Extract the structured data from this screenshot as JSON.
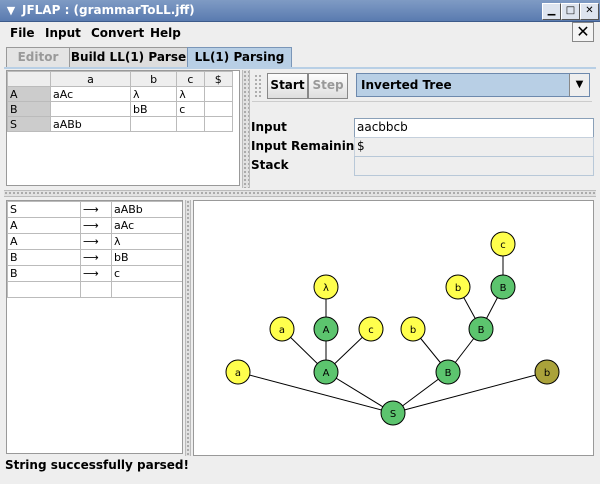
{
  "window": {
    "title": "JFLAP : (grammarToLL.jff)"
  },
  "menu": {
    "file": "File",
    "input": "Input",
    "convert": "Convert",
    "help": "Help"
  },
  "tabs": {
    "editor": "Editor",
    "build": "Build LL(1) Parse",
    "parsing": "LL(1) Parsing"
  },
  "parse_table": {
    "headers": [
      "",
      "a",
      "b",
      "c",
      "$"
    ],
    "rows": [
      [
        "A",
        "aAc",
        "λ",
        "λ",
        ""
      ],
      [
        "B",
        "",
        "bB",
        "c",
        ""
      ],
      [
        "S",
        "aABb",
        "",
        "",
        ""
      ]
    ]
  },
  "controls": {
    "start": "Start",
    "step": "Step",
    "view_mode": "Inverted Tree",
    "input_label": "Input",
    "input_value": "aacbbcb",
    "remaining_label": "Input Remaining",
    "remaining_value": "$",
    "stack_label": "Stack",
    "stack_value": ""
  },
  "grammar": {
    "arrow": "⟶",
    "productions": [
      {
        "lhs": "S",
        "rhs": "aABb"
      },
      {
        "lhs": "A",
        "rhs": "aAc"
      },
      {
        "lhs": "A",
        "rhs": "λ"
      },
      {
        "lhs": "B",
        "rhs": "bB"
      },
      {
        "lhs": "B",
        "rhs": "c"
      },
      {
        "lhs": "",
        "rhs": ""
      }
    ]
  },
  "tree": {
    "colors": {
      "nonterminal": "#5cc46e",
      "terminal": "#ffff4d",
      "terminal_active": "#aaa23a"
    },
    "nodes": [
      {
        "id": "S",
        "label": "S",
        "kind": "nonterminal"
      },
      {
        "id": "a1",
        "label": "a",
        "kind": "terminal"
      },
      {
        "id": "A1",
        "label": "A",
        "kind": "nonterminal"
      },
      {
        "id": "B1",
        "label": "B",
        "kind": "nonterminal"
      },
      {
        "id": "b_end",
        "label": "b",
        "kind": "terminal_active"
      },
      {
        "id": "a2",
        "label": "a",
        "kind": "terminal"
      },
      {
        "id": "A2",
        "label": "A",
        "kind": "nonterminal"
      },
      {
        "id": "c1",
        "label": "c",
        "kind": "terminal"
      },
      {
        "id": "lam",
        "label": "λ",
        "kind": "terminal"
      },
      {
        "id": "b2",
        "label": "b",
        "kind": "terminal"
      },
      {
        "id": "B2",
        "label": "B",
        "kind": "nonterminal"
      },
      {
        "id": "b3",
        "label": "b",
        "kind": "terminal"
      },
      {
        "id": "B3",
        "label": "B",
        "kind": "nonterminal"
      },
      {
        "id": "c2",
        "label": "c",
        "kind": "terminal"
      }
    ],
    "edges": [
      [
        "S",
        "a1"
      ],
      [
        "S",
        "A1"
      ],
      [
        "S",
        "B1"
      ],
      [
        "S",
        "b_end"
      ],
      [
        "A1",
        "a2"
      ],
      [
        "A1",
        "A2"
      ],
      [
        "A1",
        "c1"
      ],
      [
        "A2",
        "lam"
      ],
      [
        "B1",
        "b2"
      ],
      [
        "B1",
        "B2"
      ],
      [
        "B2",
        "b3"
      ],
      [
        "B2",
        "B3"
      ],
      [
        "B3",
        "c2"
      ]
    ]
  },
  "status": "String successfully parsed!"
}
